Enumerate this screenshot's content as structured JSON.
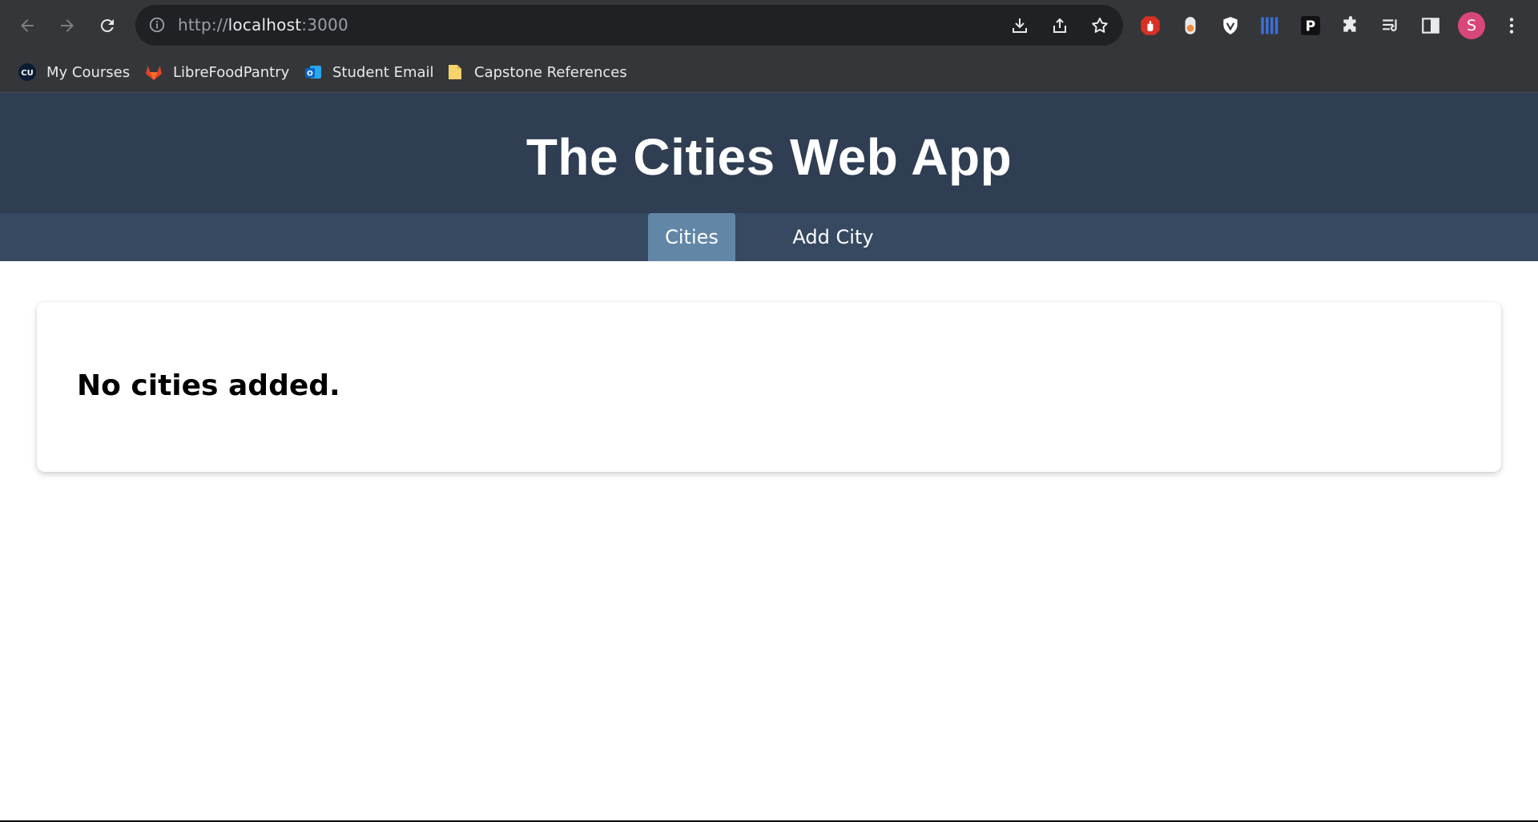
{
  "browser": {
    "url_scheme": "http://",
    "url_host": "localhost",
    "url_port": ":3000",
    "avatar_letter": "S",
    "bookmarks": [
      {
        "label": "My Courses",
        "icon": "cu-icon"
      },
      {
        "label": "LibreFoodPantry",
        "icon": "gitlab-icon"
      },
      {
        "label": "Student Email",
        "icon": "outlook-icon"
      },
      {
        "label": "Capstone References",
        "icon": "folder-icon"
      }
    ],
    "extension_icons": [
      "adblock-icon",
      "extension-orange-icon",
      "shield-icon",
      "bars-icon",
      "p-icon",
      "puzzle-icon",
      "reading-list-icon",
      "side-panel-icon"
    ]
  },
  "app": {
    "title": "The Cities Web App",
    "nav": [
      {
        "label": "Cities",
        "active": true
      },
      {
        "label": "Add City",
        "active": false
      }
    ],
    "empty_message": "No cities added."
  },
  "colors": {
    "header_bg": "#2f3e52",
    "nav_bg": "#364960",
    "nav_active_bg": "#6286a6",
    "chrome_bg": "#35363a"
  }
}
